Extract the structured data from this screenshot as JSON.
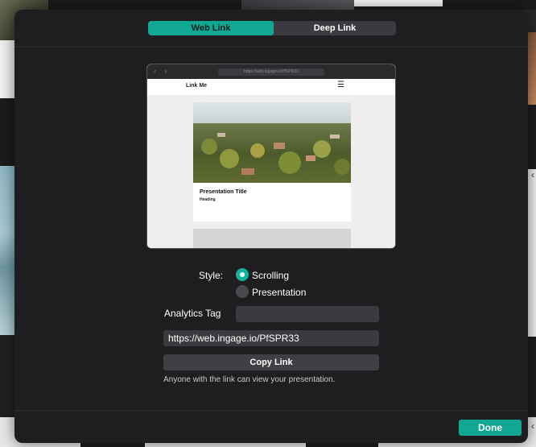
{
  "tabs": {
    "web_link": "Web Link",
    "deep_link": "Deep Link",
    "active": "web_link"
  },
  "preview": {
    "url_bar": "https://web.ingage.io/PfSPR33",
    "brand": "Link Me",
    "menu_icon": "hamburger-menu-icon",
    "card_title": "Presentation Title",
    "card_subtitle": "Heading"
  },
  "style": {
    "label": "Style:",
    "options": [
      "Scrolling",
      "Presentation"
    ],
    "selected": "Scrolling"
  },
  "analytics": {
    "label": "Analytics Tag",
    "value": ""
  },
  "link": {
    "url": "https://web.ingage.io/PfSPR33"
  },
  "actions": {
    "copy_label": "Copy Link",
    "done_label": "Done"
  },
  "hint": "Anyone with the link can view your presentation.",
  "colors": {
    "accent": "#10a893",
    "modal_bg": "#1e1e20",
    "field_bg": "#3a3a3f"
  }
}
